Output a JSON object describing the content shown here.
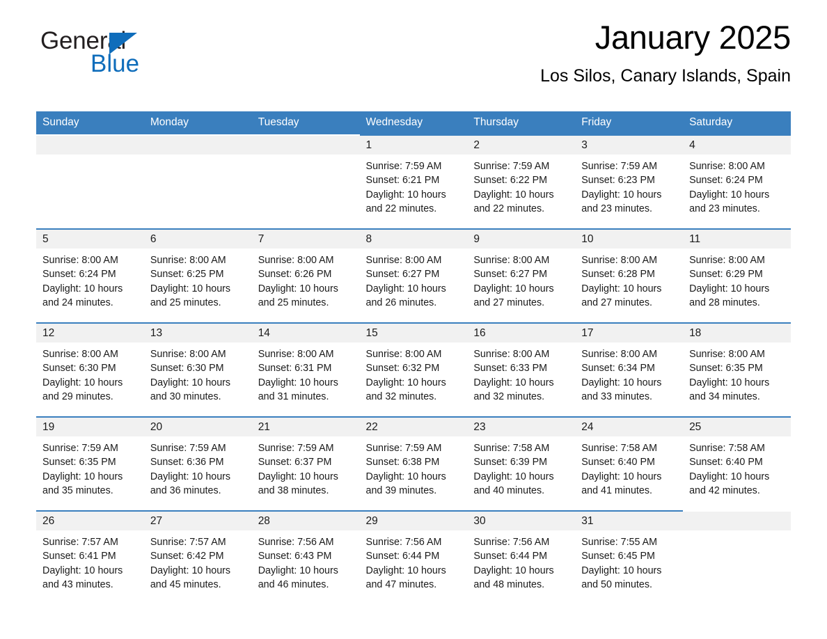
{
  "brand": {
    "name_part1": "General",
    "name_part2": "Blue",
    "triangle_color": "#0f6dbb"
  },
  "header": {
    "title": "January 2025",
    "subtitle": "Los Silos, Canary Islands, Spain"
  },
  "theme": {
    "header_blue": "#3a7fbe",
    "row_divider_blue": "#3a7fbe",
    "daynum_band": "#f1f1f1",
    "text": "#1a1a1a"
  },
  "calendar": {
    "weekday_headers": [
      "Sunday",
      "Monday",
      "Tuesday",
      "Wednesday",
      "Thursday",
      "Friday",
      "Saturday"
    ],
    "weeks": [
      [
        {
          "day": "",
          "lines": []
        },
        {
          "day": "",
          "lines": []
        },
        {
          "day": "",
          "lines": []
        },
        {
          "day": "1",
          "lines": [
            "Sunrise: 7:59 AM",
            "Sunset: 6:21 PM",
            "Daylight: 10 hours",
            "and 22 minutes."
          ]
        },
        {
          "day": "2",
          "lines": [
            "Sunrise: 7:59 AM",
            "Sunset: 6:22 PM",
            "Daylight: 10 hours",
            "and 22 minutes."
          ]
        },
        {
          "day": "3",
          "lines": [
            "Sunrise: 7:59 AM",
            "Sunset: 6:23 PM",
            "Daylight: 10 hours",
            "and 23 minutes."
          ]
        },
        {
          "day": "4",
          "lines": [
            "Sunrise: 8:00 AM",
            "Sunset: 6:24 PM",
            "Daylight: 10 hours",
            "and 23 minutes."
          ]
        }
      ],
      [
        {
          "day": "5",
          "lines": [
            "Sunrise: 8:00 AM",
            "Sunset: 6:24 PM",
            "Daylight: 10 hours",
            "and 24 minutes."
          ]
        },
        {
          "day": "6",
          "lines": [
            "Sunrise: 8:00 AM",
            "Sunset: 6:25 PM",
            "Daylight: 10 hours",
            "and 25 minutes."
          ]
        },
        {
          "day": "7",
          "lines": [
            "Sunrise: 8:00 AM",
            "Sunset: 6:26 PM",
            "Daylight: 10 hours",
            "and 25 minutes."
          ]
        },
        {
          "day": "8",
          "lines": [
            "Sunrise: 8:00 AM",
            "Sunset: 6:27 PM",
            "Daylight: 10 hours",
            "and 26 minutes."
          ]
        },
        {
          "day": "9",
          "lines": [
            "Sunrise: 8:00 AM",
            "Sunset: 6:27 PM",
            "Daylight: 10 hours",
            "and 27 minutes."
          ]
        },
        {
          "day": "10",
          "lines": [
            "Sunrise: 8:00 AM",
            "Sunset: 6:28 PM",
            "Daylight: 10 hours",
            "and 27 minutes."
          ]
        },
        {
          "day": "11",
          "lines": [
            "Sunrise: 8:00 AM",
            "Sunset: 6:29 PM",
            "Daylight: 10 hours",
            "and 28 minutes."
          ]
        }
      ],
      [
        {
          "day": "12",
          "lines": [
            "Sunrise: 8:00 AM",
            "Sunset: 6:30 PM",
            "Daylight: 10 hours",
            "and 29 minutes."
          ]
        },
        {
          "day": "13",
          "lines": [
            "Sunrise: 8:00 AM",
            "Sunset: 6:30 PM",
            "Daylight: 10 hours",
            "and 30 minutes."
          ]
        },
        {
          "day": "14",
          "lines": [
            "Sunrise: 8:00 AM",
            "Sunset: 6:31 PM",
            "Daylight: 10 hours",
            "and 31 minutes."
          ]
        },
        {
          "day": "15",
          "lines": [
            "Sunrise: 8:00 AM",
            "Sunset: 6:32 PM",
            "Daylight: 10 hours",
            "and 32 minutes."
          ]
        },
        {
          "day": "16",
          "lines": [
            "Sunrise: 8:00 AM",
            "Sunset: 6:33 PM",
            "Daylight: 10 hours",
            "and 32 minutes."
          ]
        },
        {
          "day": "17",
          "lines": [
            "Sunrise: 8:00 AM",
            "Sunset: 6:34 PM",
            "Daylight: 10 hours",
            "and 33 minutes."
          ]
        },
        {
          "day": "18",
          "lines": [
            "Sunrise: 8:00 AM",
            "Sunset: 6:35 PM",
            "Daylight: 10 hours",
            "and 34 minutes."
          ]
        }
      ],
      [
        {
          "day": "19",
          "lines": [
            "Sunrise: 7:59 AM",
            "Sunset: 6:35 PM",
            "Daylight: 10 hours",
            "and 35 minutes."
          ]
        },
        {
          "day": "20",
          "lines": [
            "Sunrise: 7:59 AM",
            "Sunset: 6:36 PM",
            "Daylight: 10 hours",
            "and 36 minutes."
          ]
        },
        {
          "day": "21",
          "lines": [
            "Sunrise: 7:59 AM",
            "Sunset: 6:37 PM",
            "Daylight: 10 hours",
            "and 38 minutes."
          ]
        },
        {
          "day": "22",
          "lines": [
            "Sunrise: 7:59 AM",
            "Sunset: 6:38 PM",
            "Daylight: 10 hours",
            "and 39 minutes."
          ]
        },
        {
          "day": "23",
          "lines": [
            "Sunrise: 7:58 AM",
            "Sunset: 6:39 PM",
            "Daylight: 10 hours",
            "and 40 minutes."
          ]
        },
        {
          "day": "24",
          "lines": [
            "Sunrise: 7:58 AM",
            "Sunset: 6:40 PM",
            "Daylight: 10 hours",
            "and 41 minutes."
          ]
        },
        {
          "day": "25",
          "lines": [
            "Sunrise: 7:58 AM",
            "Sunset: 6:40 PM",
            "Daylight: 10 hours",
            "and 42 minutes."
          ]
        }
      ],
      [
        {
          "day": "26",
          "lines": [
            "Sunrise: 7:57 AM",
            "Sunset: 6:41 PM",
            "Daylight: 10 hours",
            "and 43 minutes."
          ]
        },
        {
          "day": "27",
          "lines": [
            "Sunrise: 7:57 AM",
            "Sunset: 6:42 PM",
            "Daylight: 10 hours",
            "and 45 minutes."
          ]
        },
        {
          "day": "28",
          "lines": [
            "Sunrise: 7:56 AM",
            "Sunset: 6:43 PM",
            "Daylight: 10 hours",
            "and 46 minutes."
          ]
        },
        {
          "day": "29",
          "lines": [
            "Sunrise: 7:56 AM",
            "Sunset: 6:44 PM",
            "Daylight: 10 hours",
            "and 47 minutes."
          ]
        },
        {
          "day": "30",
          "lines": [
            "Sunrise: 7:56 AM",
            "Sunset: 6:44 PM",
            "Daylight: 10 hours",
            "and 48 minutes."
          ]
        },
        {
          "day": "31",
          "lines": [
            "Sunrise: 7:55 AM",
            "Sunset: 6:45 PM",
            "Daylight: 10 hours",
            "and 50 minutes."
          ]
        },
        {
          "day": "",
          "lines": []
        }
      ]
    ]
  }
}
